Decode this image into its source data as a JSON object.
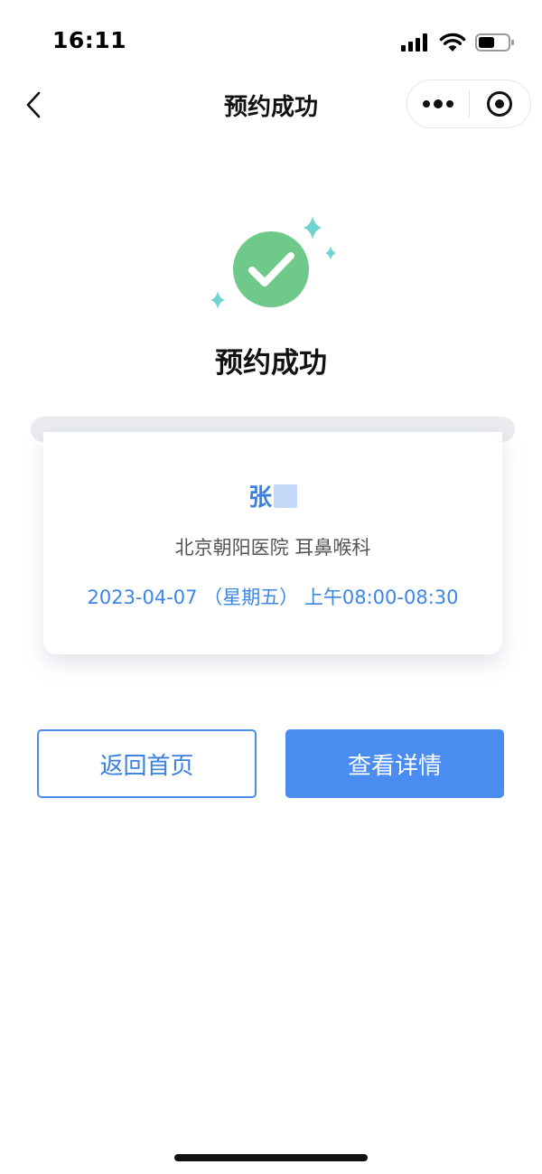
{
  "status_bar": {
    "time": "16:11",
    "icons": [
      "signal-icon",
      "wifi-icon",
      "battery-icon"
    ]
  },
  "nav": {
    "back_icon": "chevron-left-icon",
    "title": "预约成功",
    "menu_icon": "more-dots-icon",
    "close_icon": "target-circle-icon"
  },
  "result": {
    "icon": "success-check-icon",
    "title": "预约成功"
  },
  "ticket": {
    "patient_name": "张",
    "hospital_department": "北京朝阳医院 耳鼻喉科",
    "schedule": "2023-04-07 （星期五） 上午08:00-08:30"
  },
  "actions": {
    "home_label": "返回首页",
    "detail_label": "查看详情"
  },
  "colors": {
    "accent": "#4a8cf0",
    "success": "#6fc98a",
    "sparkle": "#6fd3d2"
  }
}
